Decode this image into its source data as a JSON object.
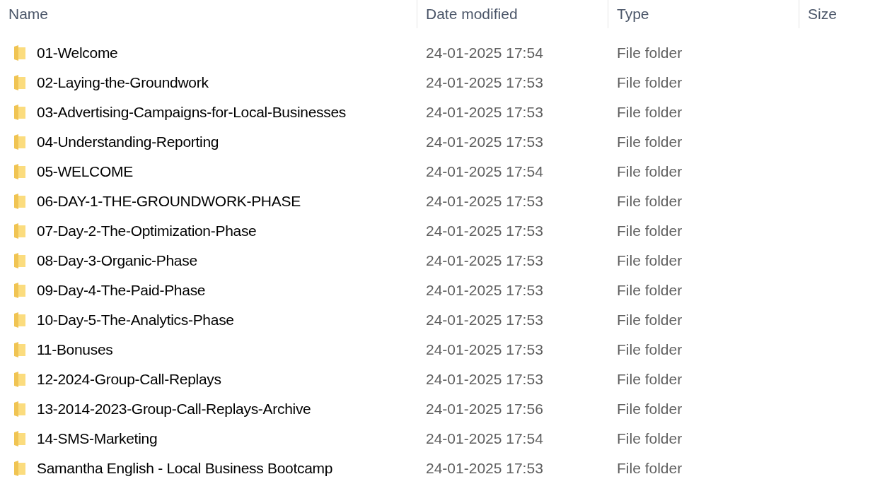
{
  "columns": [
    "Name",
    "Date modified",
    "Type",
    "Size"
  ],
  "rows": [
    {
      "name": "01-Welcome",
      "date": "24-01-2025 17:54",
      "type": "File folder"
    },
    {
      "name": "02-Laying-the-Groundwork",
      "date": "24-01-2025 17:53",
      "type": "File folder"
    },
    {
      "name": "03-Advertising-Campaigns-for-Local-Businesses",
      "date": "24-01-2025 17:53",
      "type": "File folder"
    },
    {
      "name": "04-Understanding-Reporting",
      "date": "24-01-2025 17:53",
      "type": "File folder"
    },
    {
      "name": "05-WELCOME",
      "date": "24-01-2025 17:54",
      "type": "File folder"
    },
    {
      "name": "06-DAY-1-THE-GROUNDWORK-PHASE",
      "date": "24-01-2025 17:53",
      "type": "File folder"
    },
    {
      "name": "07-Day-2-The-Optimization-Phase",
      "date": "24-01-2025 17:53",
      "type": "File folder"
    },
    {
      "name": "08-Day-3-Organic-Phase",
      "date": "24-01-2025 17:53",
      "type": "File folder"
    },
    {
      "name": "09-Day-4-The-Paid-Phase",
      "date": "24-01-2025 17:53",
      "type": "File folder"
    },
    {
      "name": "10-Day-5-The-Analytics-Phase",
      "date": "24-01-2025 17:53",
      "type": "File folder"
    },
    {
      "name": "11-Bonuses",
      "date": "24-01-2025 17:53",
      "type": "File folder"
    },
    {
      "name": "12-2024-Group-Call-Replays",
      "date": "24-01-2025 17:53",
      "type": "File folder"
    },
    {
      "name": "13-2014-2023-Group-Call-Replays-Archive",
      "date": "24-01-2025 17:56",
      "type": "File folder"
    },
    {
      "name": "14-SMS-Marketing",
      "date": "24-01-2025 17:54",
      "type": "File folder"
    },
    {
      "name": "Samantha English - Local Business Bootcamp",
      "date": "24-01-2025 17:53",
      "type": "File folder"
    }
  ]
}
